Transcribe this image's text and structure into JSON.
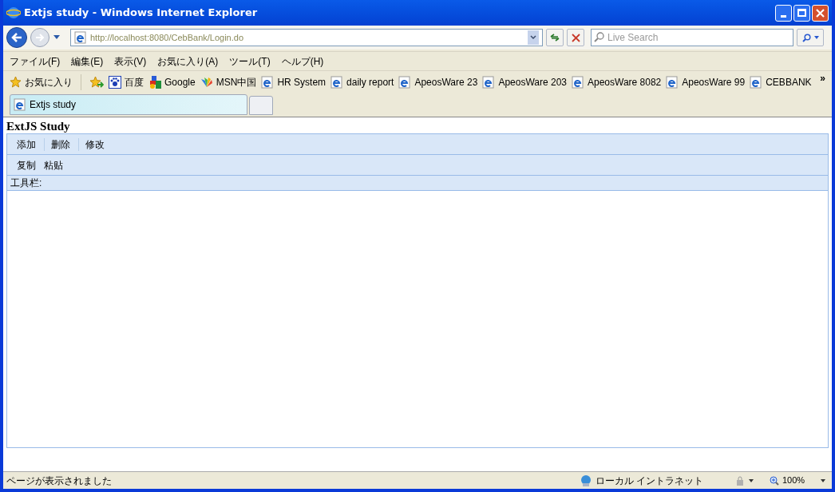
{
  "window": {
    "title": "Extjs study - Windows Internet Explorer"
  },
  "address": {
    "url": "http://localhost:8080/CebBank/Login.do"
  },
  "search": {
    "placeholder": "Live Search"
  },
  "menu": [
    "ファイル(F)",
    "編集(E)",
    "表示(V)",
    "お気に入り(A)",
    "ツール(T)",
    "ヘルプ(H)"
  ],
  "favorites": {
    "label": "お気に入り",
    "links": [
      {
        "label": "百度",
        "kind": "paw"
      },
      {
        "label": "Google",
        "kind": "google"
      },
      {
        "label": "MSN中国",
        "kind": "msn"
      },
      {
        "label": "HR System",
        "kind": "page"
      },
      {
        "label": "daily report",
        "kind": "page"
      },
      {
        "label": "ApeosWare 23",
        "kind": "page"
      },
      {
        "label": "ApeosWare 203",
        "kind": "page"
      },
      {
        "label": "ApeosWare 8082",
        "kind": "page"
      },
      {
        "label": "ApeosWare 99",
        "kind": "page"
      },
      {
        "label": "CEBBANK",
        "kind": "page"
      }
    ],
    "more": "»"
  },
  "tabs": [
    {
      "label": "Extjs study",
      "selected": true
    }
  ],
  "page": {
    "heading": "ExtJS Study",
    "toolbars": [
      {
        "kind": "separated",
        "items": [
          "添加",
          "删除",
          "修改"
        ]
      },
      {
        "kind": "plain",
        "items": [
          "复制",
          "粘贴"
        ]
      },
      {
        "kind": "label",
        "items": [
          "工具栏:"
        ]
      }
    ]
  },
  "status_bar": {
    "text": "ページが表示されました",
    "zone": "ローカル イントラネット",
    "zoom": "100%"
  }
}
